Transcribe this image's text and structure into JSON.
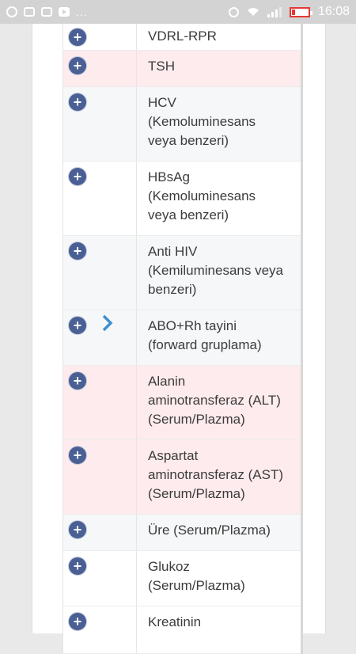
{
  "statusbar": {
    "time": "16:08",
    "dots": "..."
  },
  "rows": [
    {
      "label": "VDRL-RPR",
      "bg": "white"
    },
    {
      "label": "TSH",
      "bg": "pink"
    },
    {
      "label": "HCV\n(Kemoluminesans\nveya benzeri)",
      "bg": "gray"
    },
    {
      "label": "HBsAg\n(Kemoluminesans\nveya benzeri)",
      "bg": "white"
    },
    {
      "label": "Anti HIV\n(Kemiluminesans veya\nbenzeri)",
      "bg": "gray"
    },
    {
      "label": "ABO+Rh tayini\n(forward gruplama)",
      "bg": "gray",
      "arrow": true
    },
    {
      "label": "Alanin\naminotransferaz (ALT)\n(Serum/Plazma)",
      "bg": "pink"
    },
    {
      "label": "Aspartat\naminotransferaz (AST)\n(Serum/Plazma)",
      "bg": "pink"
    },
    {
      "label": "Üre (Serum/Plazma)",
      "bg": "gray"
    },
    {
      "label": "Glukoz\n(Serum/Plazma)",
      "bg": "white"
    },
    {
      "label": "Kreatinin",
      "bg": "white"
    }
  ],
  "icons": {
    "plus": "+",
    "arrow_color": "#3f8fd2",
    "accent": "#4a5f94",
    "row_pink": "#feebed"
  }
}
